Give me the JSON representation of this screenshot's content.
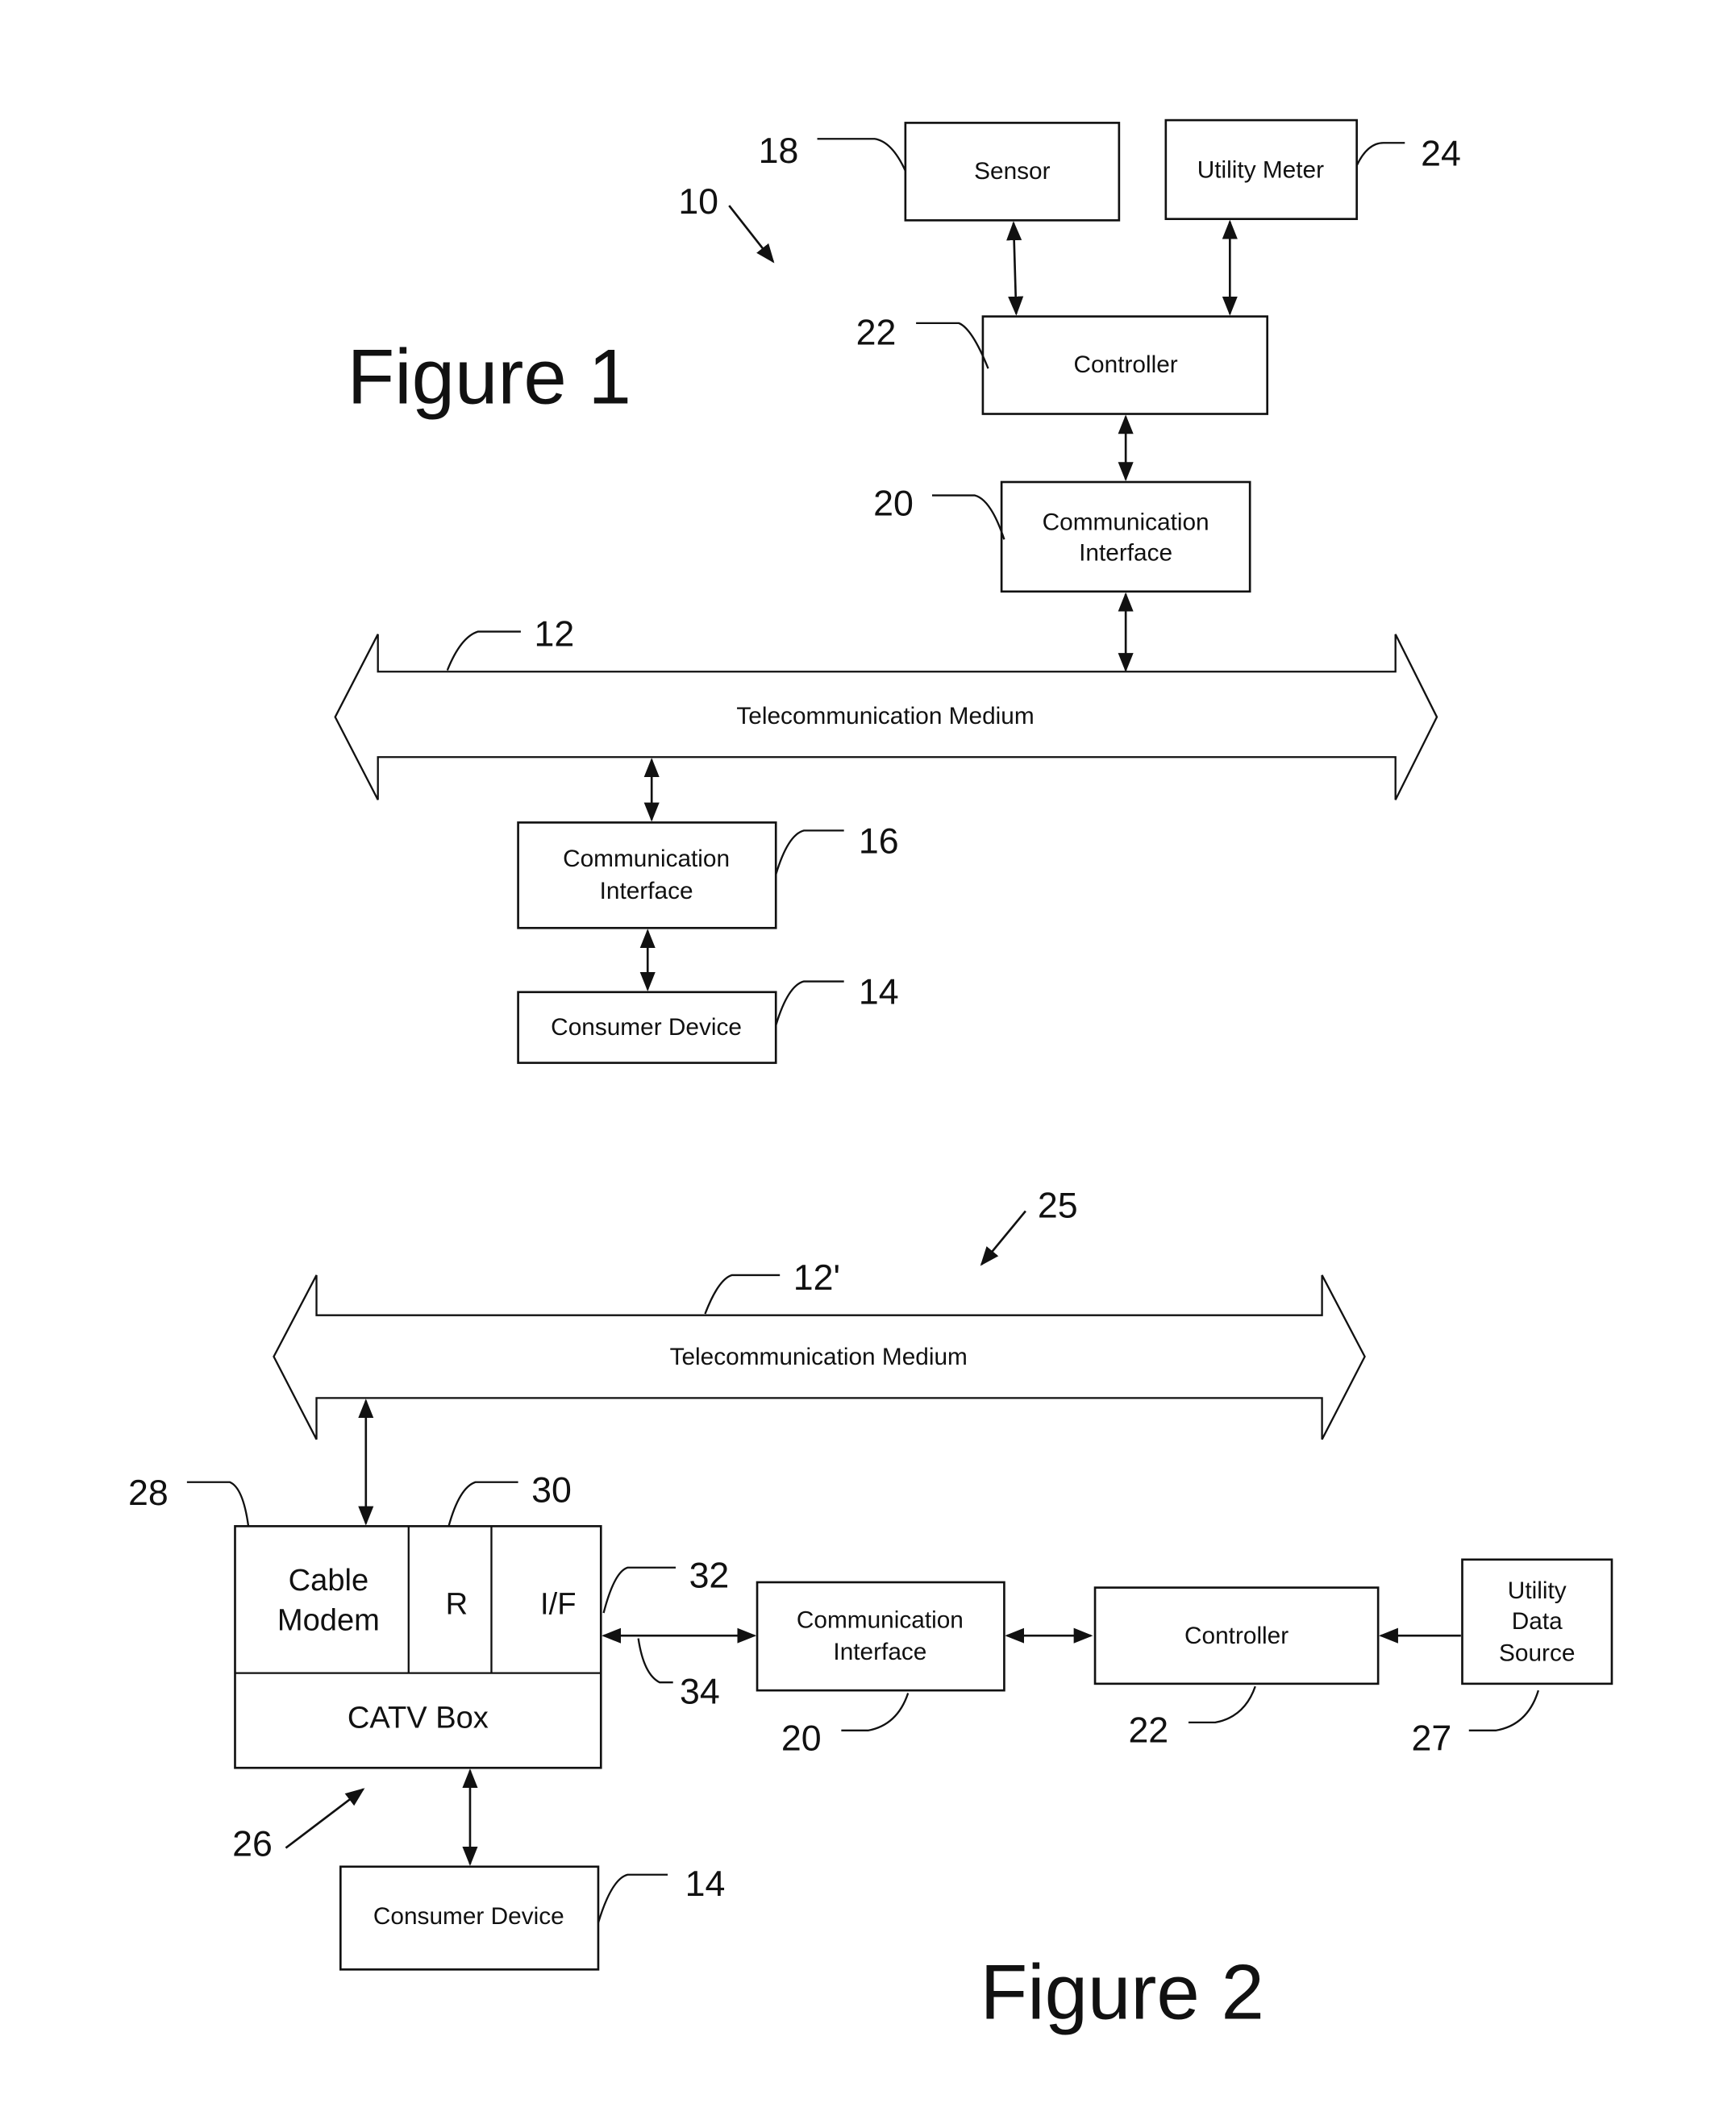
{
  "figure1": {
    "title": "Figure 1",
    "system_ref": "10",
    "blocks": {
      "sensor": {
        "label": "Sensor",
        "ref": "18"
      },
      "utility_meter": {
        "label": "Utility Meter",
        "ref": "24"
      },
      "controller": {
        "label": "Controller",
        "ref": "22"
      },
      "comm_interface_utility": {
        "label_line1": "Communication",
        "label_line2": "Interface",
        "ref": "20"
      },
      "medium": {
        "label": "Telecommunication Medium",
        "ref": "12"
      },
      "comm_interface_consumer": {
        "label_line1": "Communication",
        "label_line2": "Interface",
        "ref": "16"
      },
      "consumer_device": {
        "label": "Consumer Device",
        "ref": "14"
      }
    }
  },
  "figure2": {
    "title": "Figure 2",
    "system_ref": "25",
    "blocks": {
      "medium": {
        "label": "Telecommunication Medium",
        "ref": "12'"
      },
      "cable_modem": {
        "label_line1": "Cable",
        "label_line2": "Modem",
        "ref": "28"
      },
      "router": {
        "label": "R",
        "ref": "30"
      },
      "interface": {
        "label": "I/F",
        "ref": "32"
      },
      "catv_box": {
        "label": "CATV Box",
        "ref": "26"
      },
      "link": {
        "ref": "34"
      },
      "comm_interface": {
        "label_line1": "Communication",
        "label_line2": "Interface",
        "ref": "20"
      },
      "controller": {
        "label": "Controller",
        "ref": "22"
      },
      "utility_data_source": {
        "label_line1": "Utility",
        "label_line2": "Data",
        "label_line3": "Source",
        "ref": "27"
      },
      "consumer_device": {
        "label": "Consumer Device",
        "ref": "14"
      }
    }
  }
}
